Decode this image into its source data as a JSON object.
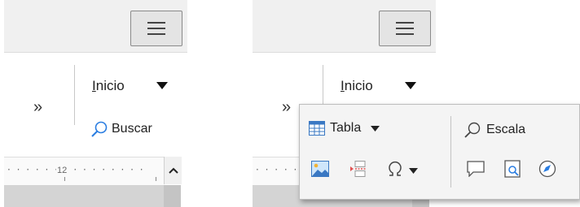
{
  "before": {
    "home_tab_label": "Inicio",
    "home_tab_accel": "I",
    "home_tab_rest": "nicio",
    "overflow_label": "»",
    "find_label": "Buscar",
    "ruler_value": "12"
  },
  "after": {
    "home_tab_accel": "I",
    "home_tab_rest": "nicio",
    "overflow_label": "»",
    "popup": {
      "table_label": "Tabla",
      "zoom_label": "Escala",
      "icons": [
        "table-icon",
        "image-icon",
        "page-break-icon",
        "special-character-icon",
        "zoom-icon",
        "comment-icon",
        "print-preview-icon",
        "navigator-icon"
      ]
    }
  },
  "colors": {
    "accent": "#2a7de1",
    "table_blue": "#3a78c3",
    "break_red": "#e05050"
  }
}
